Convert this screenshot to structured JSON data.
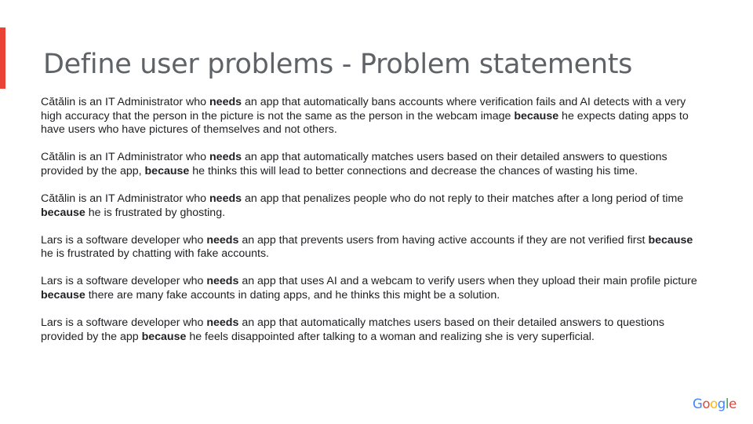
{
  "slide": {
    "title": "Define user problems - Problem statements",
    "accent_color": "#ea4335"
  },
  "statements": [
    {
      "p1": "Cătălin is an IT Administrator who ",
      "needs": "needs",
      "p2": " an app that automatically bans accounts where verification fails and AI detects with a very high accuracy that the person in the picture is not the same as the person in the webcam image ",
      "because": "because",
      "p3": " he expects dating apps to have users who have pictures of themselves and not others."
    },
    {
      "p1": "Cătălin is an IT Administrator who ",
      "needs": "needs",
      "p2": " an app that automatically matches users based on their detailed answers to questions provided by the app, ",
      "because": "because",
      "p3": " he thinks this will lead to better connections and decrease the chances of wasting his time."
    },
    {
      "p1": "Cătălin is an IT Administrator who ",
      "needs": "needs",
      "p2": " an app that penalizes people who do not reply to their matches after a long period of time ",
      "because": "because",
      "p3": " he is frustrated by ghosting."
    },
    {
      "p1": "Lars is a software developer who ",
      "needs": "needs",
      "p2": " an app that prevents users from having active accounts if they are not verified first ",
      "because": "because",
      "p3": " he is frustrated by chatting with fake accounts."
    },
    {
      "p1": "Lars is a software developer who ",
      "needs": "needs",
      "p2": " an app that uses AI and a webcam to verify users when they upload their main profile picture ",
      "because": "because",
      "p3": " there are many fake accounts in dating apps, and he thinks this might be a solution."
    },
    {
      "p1": "Lars is a software developer who ",
      "needs": "needs",
      "p2": " an app that automatically matches users based on their detailed answers to questions provided by the app ",
      "because": "because",
      "p3": " he feels disappointed after talking to a woman and realizing she is very superficial."
    }
  ],
  "logo": {
    "letters": [
      "G",
      "o",
      "o",
      "g",
      "l",
      "e"
    ],
    "colors": [
      "#4285f4",
      "#ea4335",
      "#fbbc05",
      "#4285f4",
      "#34a853",
      "#ea4335"
    ]
  }
}
